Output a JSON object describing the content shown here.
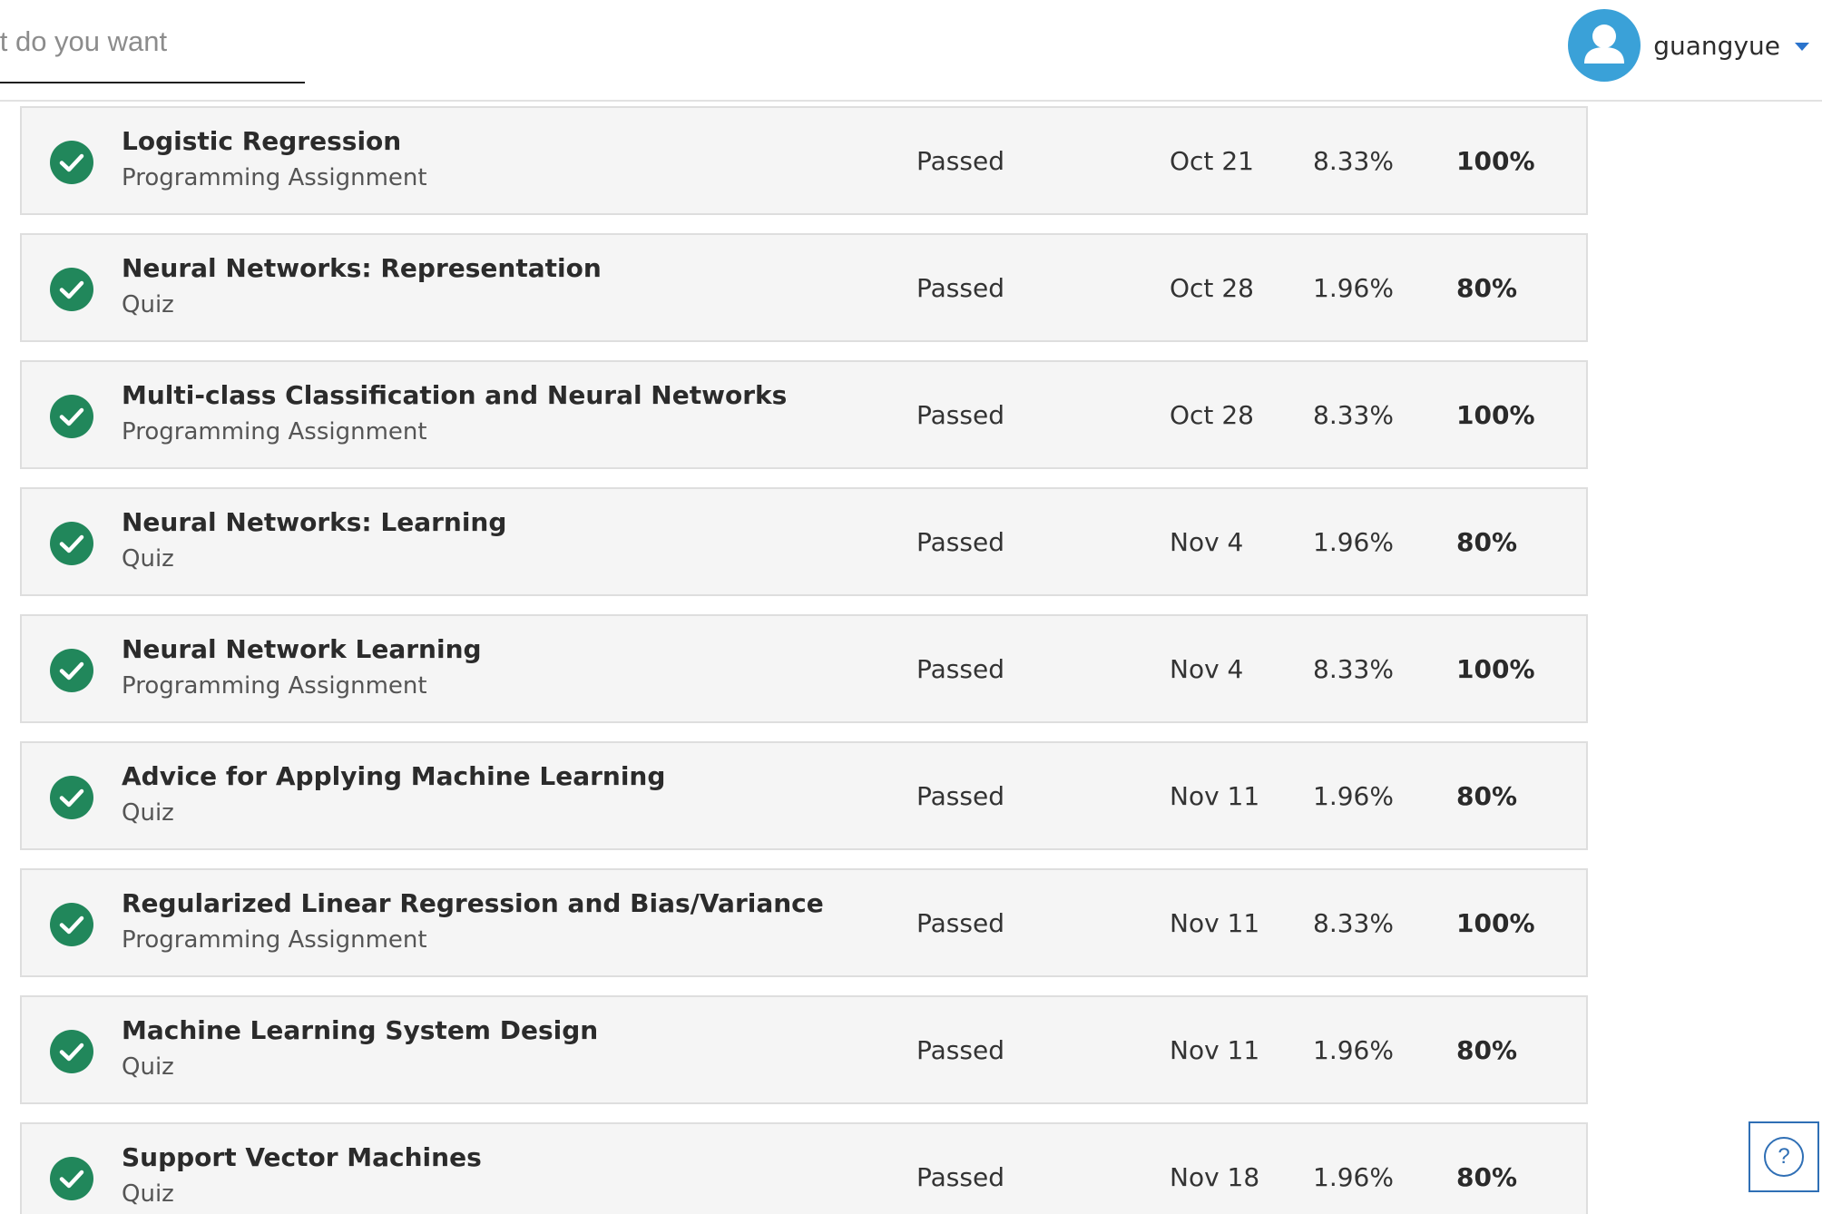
{
  "header": {
    "search": {
      "placeholder": "What do you want to learn?",
      "icon": "search-icon"
    },
    "user": {
      "name": "guangyue",
      "avatar_icon": "user-icon",
      "dropdown_icon": "chevron-down-icon"
    }
  },
  "colors": {
    "accent": "#2a73cc",
    "avatar": "#3aa1d8",
    "check": "#21875b",
    "row_bg": "#f5f5f5",
    "row_border": "#dedede"
  },
  "grades": {
    "rows": [
      {
        "title": "Logistic Regression",
        "type": "Programming Assignment",
        "status": "Passed",
        "due": "Oct 21",
        "weight": "8.33%",
        "grade": "100%"
      },
      {
        "title": "Neural Networks: Representation",
        "type": "Quiz",
        "status": "Passed",
        "due": "Oct 28",
        "weight": "1.96%",
        "grade": "80%"
      },
      {
        "title": "Multi-class Classification and Neural Networks",
        "type": "Programming Assignment",
        "status": "Passed",
        "due": "Oct 28",
        "weight": "8.33%",
        "grade": "100%"
      },
      {
        "title": "Neural Networks: Learning",
        "type": "Quiz",
        "status": "Passed",
        "due": "Nov 4",
        "weight": "1.96%",
        "grade": "80%"
      },
      {
        "title": "Neural Network Learning",
        "type": "Programming Assignment",
        "status": "Passed",
        "due": "Nov 4",
        "weight": "8.33%",
        "grade": "100%"
      },
      {
        "title": "Advice for Applying Machine Learning",
        "type": "Quiz",
        "status": "Passed",
        "due": "Nov 11",
        "weight": "1.96%",
        "grade": "80%"
      },
      {
        "title": "Regularized Linear Regression and Bias/Variance",
        "type": "Programming Assignment",
        "status": "Passed",
        "due": "Nov 11",
        "weight": "8.33%",
        "grade": "100%"
      },
      {
        "title": "Machine Learning System Design",
        "type": "Quiz",
        "status": "Passed",
        "due": "Nov 11",
        "weight": "1.96%",
        "grade": "80%"
      },
      {
        "title": "Support Vector Machines",
        "type": "Quiz",
        "status": "Passed",
        "due": "Nov 18",
        "weight": "1.96%",
        "grade": "80%"
      }
    ]
  },
  "help": {
    "label": "?",
    "icon": "help-icon"
  }
}
